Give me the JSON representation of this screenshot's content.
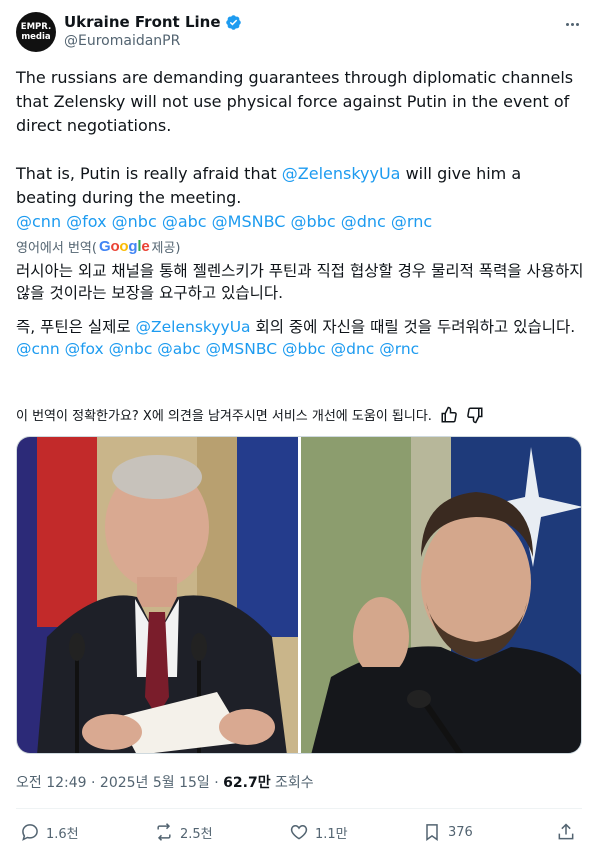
{
  "author": {
    "avatar_line1": "EMPR.",
    "avatar_line2": "media",
    "display_name": "Ukraine Front Line",
    "handle": "@EuromaidanPR"
  },
  "tweet": {
    "para1": "The russians are demanding guarantees through diplomatic channels that Zelensky will not use physical force against Putin in the event of direct negotiations.",
    "para2_before": "That is, Putin is really afraid that ",
    "para2_mention": "@ZelenskyyUa",
    "para2_after": " will give him a beating during the meeting.",
    "tags": "@cnn @fox @nbc @abc @MSNBC @bbc @dnc @rnc"
  },
  "translation": {
    "prefix": "영어에서 번역(",
    "google": "Google",
    "suffix": " 제공)",
    "para1": "러시아는 외교 채널을 통해 젤렌스키가 푸틴과 직접 협상할 경우 물리적 폭력을 사용하지 않을 것이라는 보장을 요구하고 있습니다.",
    "para2_before": "즉, 푸틴은 실제로 ",
    "para2_mention": "@ZelenskyyUa",
    "para2_after": " 회의 중에 자신을 때릴 것을 두려워하고 있습니다.",
    "tags": "@cnn @fox @nbc @abc @MSNBC @bbc @dnc @rnc",
    "feedback": "이 번역이 정확한가요? X에 의견을 남겨주시면 서비스 개선에 도움이 됩니다."
  },
  "meta": {
    "time": "오전 12:49 · 2025년 5월 15일 · ",
    "views": "62.7만",
    "views_label": " 조회수"
  },
  "actions": {
    "replies": "1.6천",
    "reposts": "2.5천",
    "likes": "1.1만",
    "bookmarks": "376"
  },
  "colors": {
    "accent": "#1d9bf0",
    "text": "#0f1419",
    "muted": "#536471"
  }
}
